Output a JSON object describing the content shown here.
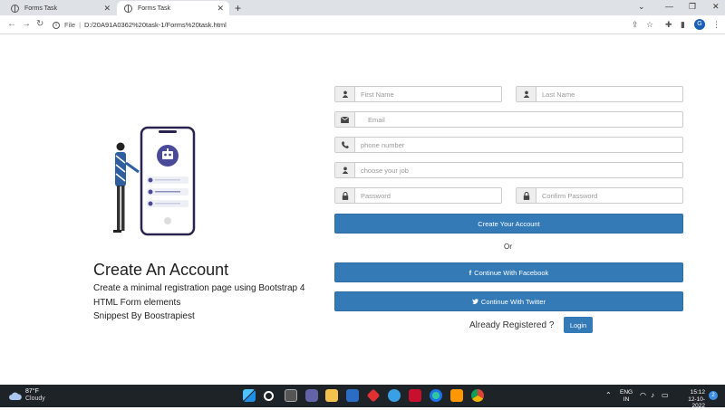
{
  "browser": {
    "tabs": [
      {
        "title": "Forms Task",
        "active": false
      },
      {
        "title": "Forms Task",
        "active": true
      }
    ],
    "url_label": "File",
    "url": "D:/20A91A0362%20task-1/Forms%20task.html",
    "profile_initial": "G"
  },
  "left": {
    "heading": "Create An Account",
    "description_lines": [
      "Create a minimal registration page using Bootstrap 4",
      "HTML Form elements",
      "Snippest By Boostrapiest"
    ]
  },
  "form": {
    "first_name_placeholder": "First Name",
    "last_name_placeholder": "Last Name",
    "email_placeholder": "Email",
    "phone_placeholder": "phone number",
    "job_placeholder": "choose your job",
    "password_placeholder": "Password",
    "confirm_password_placeholder": "Confirm Password",
    "create_button": "Create Your Account",
    "or_text": "Or",
    "facebook_button": "Continue With Facebook",
    "twitter_button": "Continue With Twitter",
    "already_text": "Already Registered ?",
    "login_button": "Login"
  },
  "taskbar": {
    "temperature": "87°F",
    "condition": "Cloudy",
    "lang_top": "ENG",
    "lang_bottom": "IN",
    "time": "15:12",
    "date": "12-10-2022",
    "notification_count": "2"
  },
  "colors": {
    "primary": "#337ab7",
    "tabbar": "#dee1e6",
    "taskbar": "#1e2328"
  }
}
